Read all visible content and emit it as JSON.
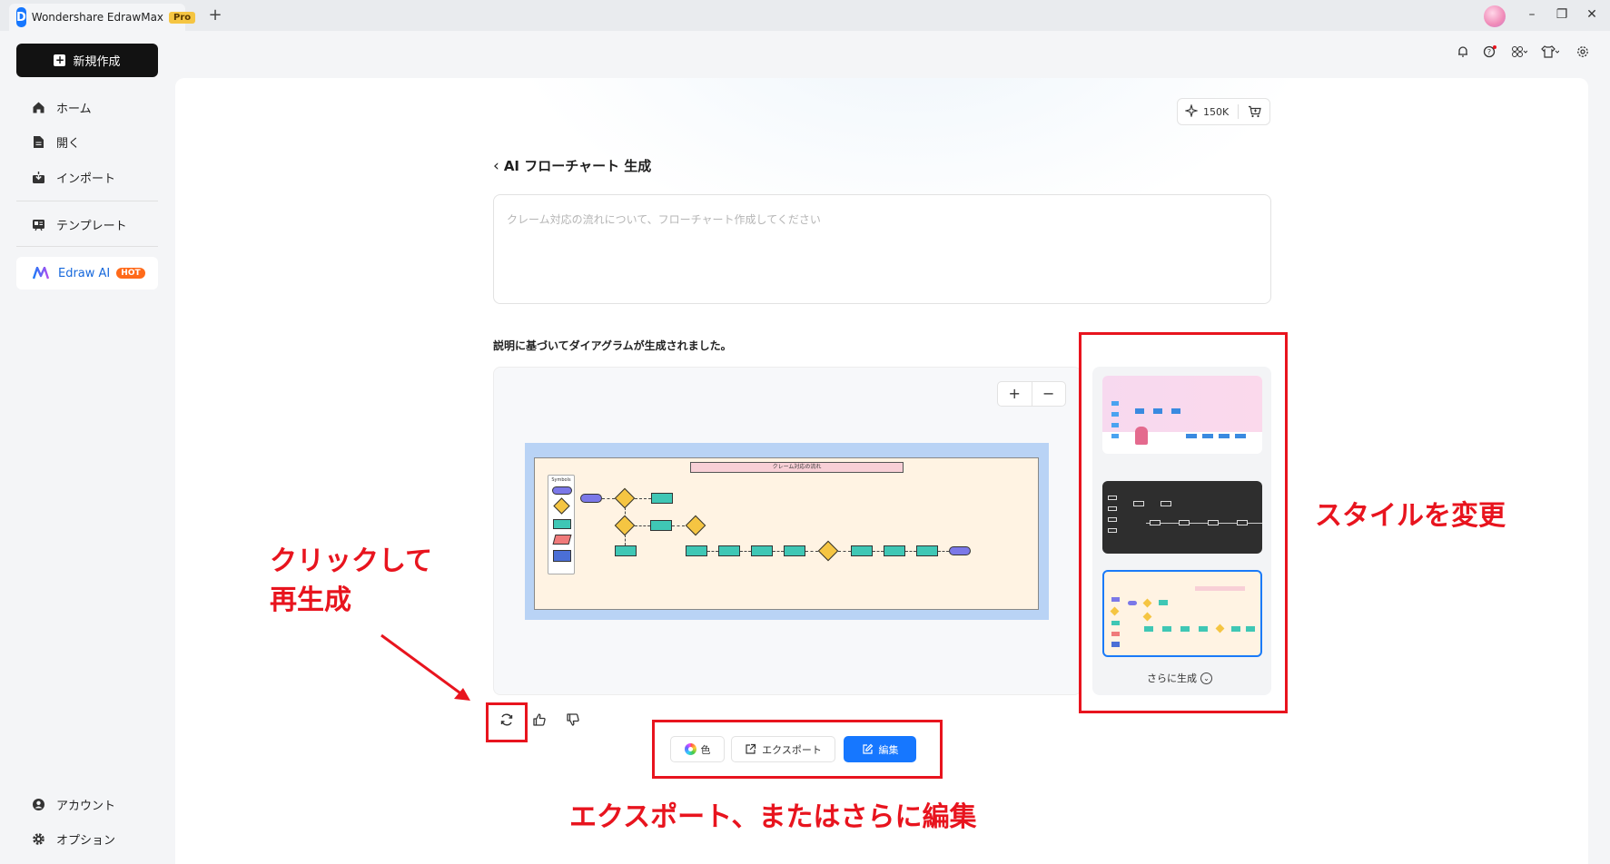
{
  "titlebar": {
    "app_title": "Wondershare EdrawMax",
    "badge": "Pro",
    "new_tab": "+",
    "controls": {
      "minimize": "–",
      "restore": "❐",
      "close": "✕"
    }
  },
  "sidebar": {
    "new_button": "新規作成",
    "items": [
      {
        "label": "ホーム",
        "icon": "home-icon"
      },
      {
        "label": "開く",
        "icon": "file-icon"
      },
      {
        "label": "インポート",
        "icon": "import-icon"
      },
      {
        "label": "テンプレート",
        "icon": "template-icon"
      }
    ],
    "ai_item": {
      "label": "Edraw AI",
      "badge": "HOT"
    },
    "bottom_items": [
      {
        "label": "アカウント",
        "icon": "account-icon"
      },
      {
        "label": "オプション",
        "icon": "gear-icon"
      }
    ]
  },
  "header": {
    "credits": "150K"
  },
  "main": {
    "title": "AI フローチャート 生成",
    "prompt_placeholder": "クレーム対応の流れについて、フローチャート作成してください",
    "result_text": "説明に基づいてダイアグラムが生成されました。",
    "zoom_in": "+",
    "zoom_out": "−",
    "diagram": {
      "title": "クレーム対応の流れ",
      "legend_title": "Symbols"
    },
    "more_generate": "さらに生成",
    "actions": {
      "color": "色",
      "export": "エクスポート",
      "edit": "編集"
    }
  },
  "annotations": {
    "regenerate": [
      "クリックして",
      "再生成"
    ],
    "style": "スタイルを変更",
    "export_edit": "エクスポート、またはさらに編集"
  },
  "colors": {
    "accent": "#1677ff",
    "annotation_red": "#e8141e",
    "hot_badge": "#ff6a1a"
  }
}
